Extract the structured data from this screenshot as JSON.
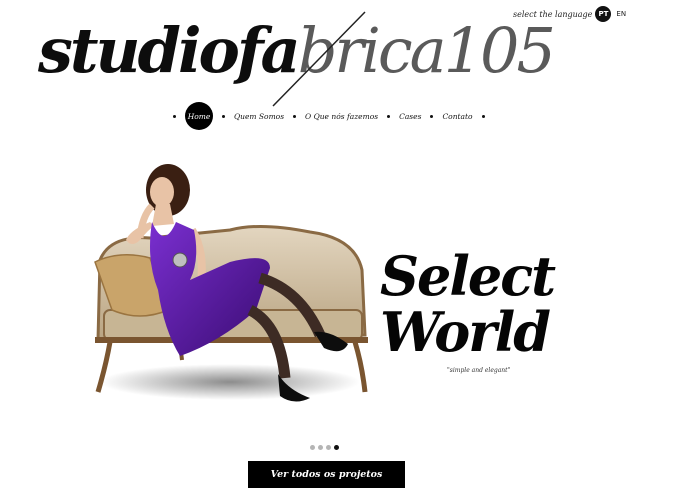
{
  "language": {
    "label": "select the language",
    "options": [
      "PT",
      "EN"
    ],
    "selected": "PT"
  },
  "logo": {
    "part1": "studiofa",
    "part2": "brica105"
  },
  "nav": {
    "items": [
      "Home",
      "Quem Somos",
      "O Que nós fazemos",
      "Cases",
      "Contato"
    ],
    "active": "Home"
  },
  "hero": {
    "headline_line1": "Select",
    "headline_line2": "World",
    "tagline": "\"simple and elegant\""
  },
  "slider": {
    "count": 4,
    "active_index": 3
  },
  "cta": {
    "label": "Ver todos os projetos"
  },
  "colors": {
    "accent": "#000000",
    "dress": "#5a1a9a",
    "sofa": "#c9b79a"
  }
}
